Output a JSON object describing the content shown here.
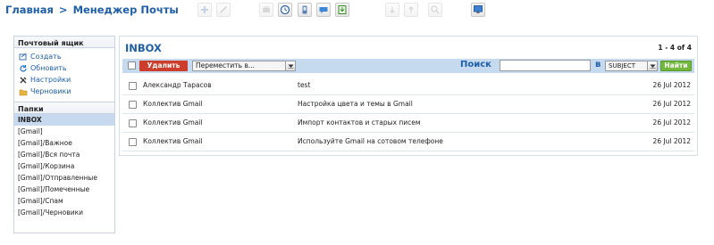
{
  "header": {
    "breadcrumb_home": "Главная",
    "breadcrumb_sep": ">",
    "breadcrumb_current": "Менеджер Почты",
    "toolbar": [
      {
        "icon": "add-icon",
        "disabled": true
      },
      {
        "icon": "edit-icon",
        "disabled": true
      },
      {
        "icon": "print-icon",
        "disabled": true
      },
      {
        "icon": "clock-icon",
        "disabled": false
      },
      {
        "icon": "phone-icon",
        "disabled": false
      },
      {
        "icon": "chat-icon",
        "disabled": false
      },
      {
        "icon": "download-icon",
        "disabled": false
      },
      {
        "icon": "arrow-down-icon",
        "disabled": true
      },
      {
        "icon": "arrow-up-icon",
        "disabled": true
      },
      {
        "icon": "zoom-icon",
        "disabled": true
      },
      {
        "icon": "monitor-icon",
        "disabled": false
      }
    ]
  },
  "sidebar": {
    "mailbox_title": "Почтовый ящик",
    "actions": [
      {
        "label": "Создать",
        "icon": "compose-icon"
      },
      {
        "label": "Обновить",
        "icon": "refresh-icon"
      },
      {
        "label": "Настройки",
        "icon": "settings-icon"
      },
      {
        "label": "Черновики",
        "icon": "drafts-folder-icon"
      }
    ],
    "folders_title": "Папки",
    "folders": [
      {
        "label": "INBOX",
        "active": true
      },
      {
        "label": "[Gmail]",
        "active": false
      },
      {
        "label": "[Gmail]/Важное",
        "active": false
      },
      {
        "label": "[Gmail]/Вся почта",
        "active": false
      },
      {
        "label": "[Gmail]/Корзина",
        "active": false
      },
      {
        "label": "[Gmail]/Отправленные",
        "active": false
      },
      {
        "label": "[Gmail]/Помеченные",
        "active": false
      },
      {
        "label": "[Gmail]/Спам",
        "active": false
      },
      {
        "label": "[Gmail]/Черновики",
        "active": false
      }
    ]
  },
  "main": {
    "title": "INBOX",
    "count": "1 - 4 of 4",
    "delete_label": "Удалить",
    "move_label": "Переместить в...",
    "search_label": "Поиск",
    "search_value": "",
    "in_label": "в",
    "field_value": "SUBJECT",
    "find_label": "Найти",
    "messages": [
      {
        "from": "Александр Тарасов",
        "subject": "test",
        "date": "26 Jul 2012"
      },
      {
        "from": "Коллектив Gmail",
        "subject": "Настройка цвета и темы в Gmail",
        "date": "26 Jul 2012"
      },
      {
        "from": "Коллектив Gmail",
        "subject": "Импорт контактов и старых писем",
        "date": "26 Jul 2012"
      },
      {
        "from": "Коллектив Gmail",
        "subject": "Используйте Gmail на сотовом телефоне",
        "date": "26 Jul 2012"
      }
    ]
  },
  "colors": {
    "link_blue": "#1f5fa8",
    "action_bar": "#c5d9ef",
    "delete_red": "#cc3d2b",
    "find_green": "#72b83c",
    "active_folder": "#c6d9ee"
  }
}
